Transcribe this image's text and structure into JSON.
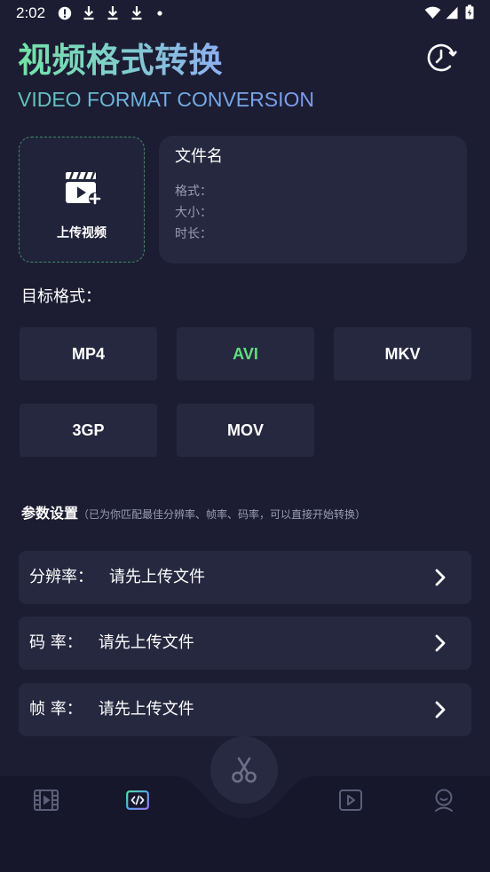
{
  "status_bar": {
    "time": "2:02",
    "left_icons": [
      "alert-circle-icon",
      "download-icon",
      "download-icon",
      "download-icon",
      "dot-icon"
    ],
    "right_icons": [
      "wifi-icon",
      "signal-icon",
      "battery-charging-icon"
    ]
  },
  "header": {
    "title": "视频格式转换",
    "subtitle": "VIDEO FORMAT CONVERSION",
    "history_icon": "history-clock-icon"
  },
  "upload": {
    "label": "上传视频",
    "icon": "video-add-icon"
  },
  "file_info": {
    "name_label": "文件名",
    "format_label": "格式：",
    "size_label": "大小：",
    "duration_label": "时长："
  },
  "target_format": {
    "label": "目标格式：",
    "options": [
      {
        "label": "MP4",
        "selected": false
      },
      {
        "label": "AVI",
        "selected": true
      },
      {
        "label": "MKV",
        "selected": false
      },
      {
        "label": "3GP",
        "selected": false
      },
      {
        "label": "MOV",
        "selected": false
      }
    ]
  },
  "params": {
    "title": "参数设置",
    "hint": "（已为你匹配最佳分辨率、帧率、码率，可以直接开始转换）",
    "rows": [
      {
        "label": "分辨率：",
        "value": "请先上传文件",
        "icon": "chevron-right-icon"
      },
      {
        "label": "码 率：",
        "value": "请先上传文件",
        "icon": "chevron-right-icon"
      },
      {
        "label": "帧 率：",
        "value": "请先上传文件",
        "icon": "chevron-right-icon"
      }
    ]
  },
  "bottom_nav": {
    "items": [
      {
        "icon": "film-icon",
        "active": false
      },
      {
        "icon": "code-icon",
        "active": true
      },
      {
        "icon": "play-icon",
        "active": false
      },
      {
        "icon": "avatar-icon",
        "active": false
      }
    ],
    "center_button_icon": "scissors-icon"
  },
  "colors": {
    "background": "#1c1d33",
    "card": "#262840",
    "nav_background": "#16172b",
    "accent_green": "#5ee07c",
    "muted_text": "#9a9cb2",
    "inactive_icon": "#5d5f78",
    "upload_border": "#3f8d63"
  }
}
